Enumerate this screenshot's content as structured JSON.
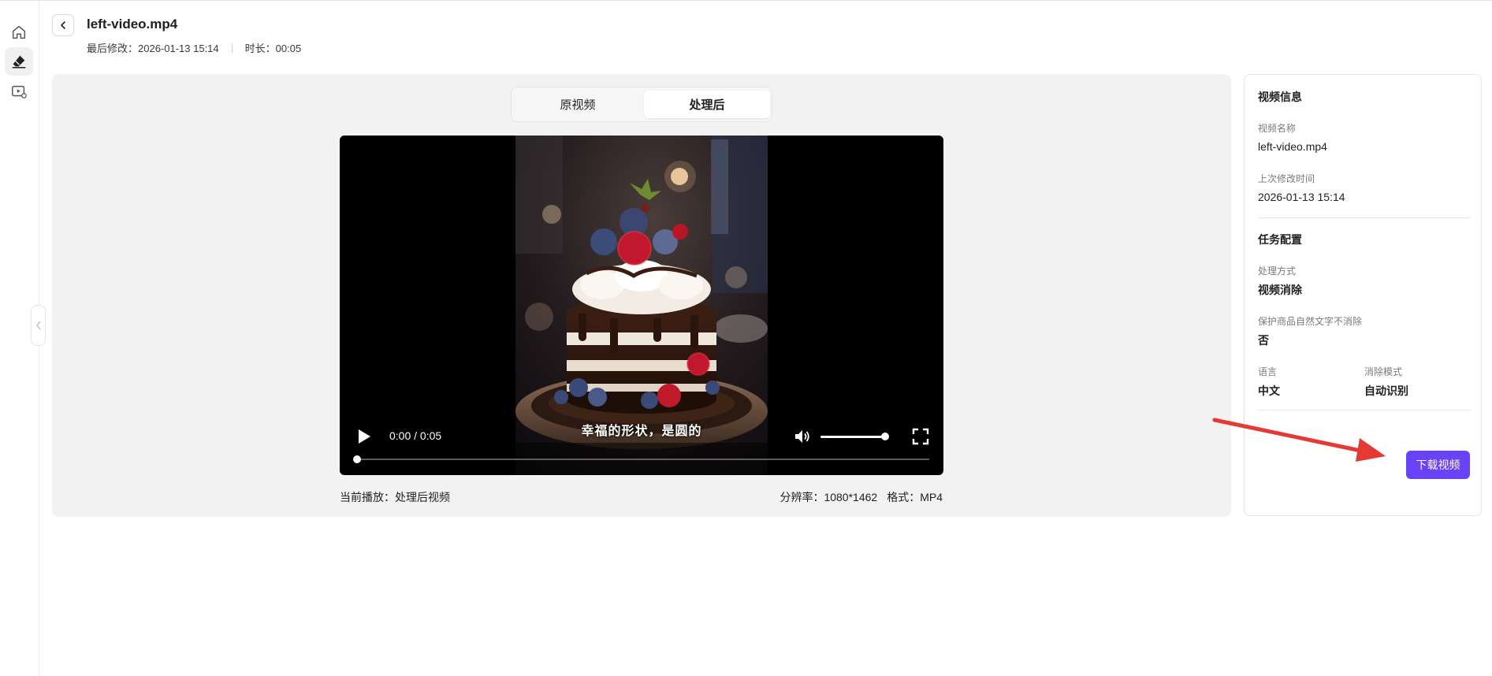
{
  "header": {
    "title": "left-video.mp4",
    "modified": "最后修改：2026-01-13 15:14",
    "duration": "时长：00:05"
  },
  "sidebar": {
    "items": [
      {
        "icon": "home-icon"
      },
      {
        "icon": "eraser-icon",
        "active": true
      },
      {
        "icon": "video-library-icon"
      }
    ]
  },
  "tabs": [
    {
      "label": "原视频"
    },
    {
      "label": "处理后",
      "active": true
    }
  ],
  "player": {
    "subtitle": "幸福的形状，是圆的",
    "time": "0:00 / 0:05",
    "progress": 0,
    "volume": 1.0
  },
  "footer": {
    "now_playing": "当前播放：处理后视频",
    "resolution": "分辨率：1080*1462",
    "format": "格式：MP4"
  },
  "info": {
    "video_section": "视频信息",
    "name_label": "视频名称",
    "name_value": "left-video.mp4",
    "modified_label": "上次修改时间",
    "modified_value": "2026-01-13 15:14",
    "task_section": "任务配置",
    "method_label": "处理方式",
    "method_value": "视频消除",
    "protect_label": "保护商品自然文字不消除",
    "protect_value": "否",
    "lang_label": "语言",
    "lang_value": "中文",
    "mode_label": "消除模式",
    "mode_value": "自动识别",
    "download_label": "下载视频"
  },
  "colors": {
    "accent": "#6a42f5",
    "annotation_arrow": "#e53935",
    "panel_bg": "#f2f2f2"
  }
}
